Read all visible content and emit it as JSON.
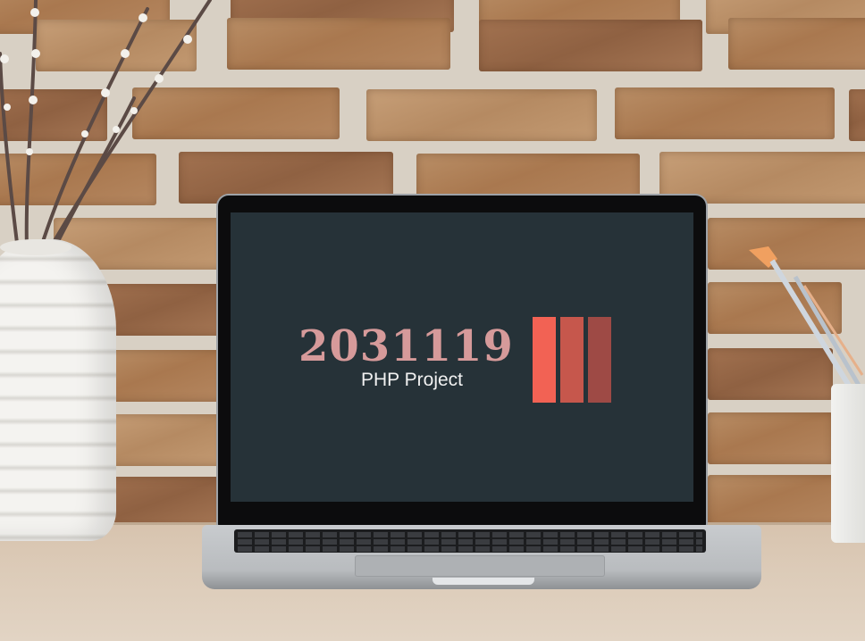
{
  "screen": {
    "title": "2031119",
    "subtitle": "PHP Project",
    "colors": {
      "background": "#263238",
      "title": "#d69a9a",
      "subtitle": "#f0f0f0",
      "bar1": "#f26254",
      "bar2": "#c6574c",
      "bar3": "#9e4a45"
    }
  },
  "objects": [
    "white-vase",
    "pussy-willow-branches",
    "laptop",
    "brush-cup",
    "brick-wall",
    "wooden-desk"
  ]
}
